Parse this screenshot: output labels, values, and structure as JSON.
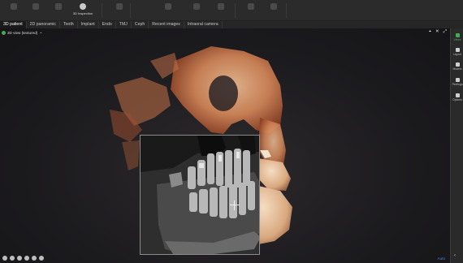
{
  "toolbar": {
    "buttons": [
      {
        "label": "",
        "icon": "file-icon"
      },
      {
        "label": "",
        "icon": "print-icon"
      },
      {
        "label": "",
        "icon": "export-icon"
      },
      {
        "label": "3D Inspection",
        "icon": "inspection-icon",
        "active": true
      },
      {
        "label": "",
        "icon": "screenshot-icon"
      },
      {
        "label": "",
        "icon": "measure-icon"
      },
      {
        "label": "",
        "icon": "annotation-icon"
      },
      {
        "label": "",
        "icon": "layers-icon"
      },
      {
        "label": "",
        "icon": "settings-icon"
      },
      {
        "label": "",
        "icon": "help-icon"
      }
    ]
  },
  "tabs": [
    "3D patient",
    "2D panoramic",
    "Tooth",
    "Implant",
    "Endo",
    "TMJ",
    "Ceph",
    "Recent images",
    "Intraoral camera"
  ],
  "active_tab": 0,
  "viewport": {
    "title": "3D view (textured)",
    "tools": [
      "pin-icon",
      "close-icon",
      "expand-icon"
    ],
    "bottom_tools": [
      "view-front-icon",
      "view-left-icon",
      "view-right-icon",
      "view-top-icon",
      "view-bottom-icon",
      "lock-icon"
    ],
    "autofit": "Auto"
  },
  "sidebar": {
    "items": [
      {
        "label": "Views",
        "icon": "views-icon",
        "active": true
      },
      {
        "label": "Layout",
        "icon": "layout-icon"
      },
      {
        "label": "Models",
        "icon": "models-icon"
      },
      {
        "label": "Findings",
        "icon": "findings-icon"
      },
      {
        "label": "Options",
        "icon": "options-icon"
      }
    ],
    "collapse": "‹"
  },
  "colors": {
    "accent": "#3fb04d",
    "bone": "#e0a071",
    "link": "#4a8fd6"
  }
}
